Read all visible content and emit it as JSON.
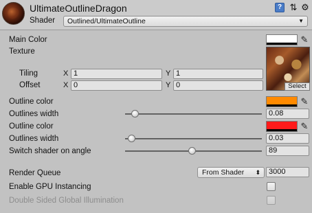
{
  "header": {
    "material_name": "UltimateOutlineDragon",
    "shader_label": "Shader",
    "shader_value": "Outlined/UltimateOutline",
    "icons": [
      "material-preview-icon",
      "help-icon",
      "settings-icon",
      "gear-icon"
    ]
  },
  "properties": {
    "main_color": {
      "label": "Main Color",
      "color": "#ffffff"
    },
    "texture": {
      "label": "Texture",
      "tiling_label": "Tiling",
      "offset_label": "Offset",
      "tiling_x": "1",
      "tiling_y": "1",
      "offset_x": "0",
      "offset_y": "0",
      "x_label": "X",
      "y_label": "Y",
      "select_label": "Select"
    },
    "outline_color_1": {
      "label": "Outline color",
      "color": "#ff8a00"
    },
    "outline_width_1": {
      "label": "Outlines width",
      "value": "0.08",
      "fraction": 0.05
    },
    "outline_color_2": {
      "label": "Outline color",
      "color": "#ff1a1a"
    },
    "outline_width_2": {
      "label": "Outlines width",
      "value": "0.03",
      "fraction": 0.02
    },
    "switch_shader": {
      "label": "Switch shader on angle",
      "value": "89",
      "fraction": 0.49
    }
  },
  "advanced": {
    "render_queue_label": "Render Queue",
    "render_queue_mode": "From Shader",
    "render_queue_value": "3000",
    "gpu_instancing_label": "Enable GPU Instancing",
    "gpu_instancing_checked": false,
    "double_sided_gi_label": "Double Sided Global Illumination",
    "double_sided_gi_checked": false
  },
  "colors": {
    "panel_bg": "#c2c2c2",
    "header_bg": "#cbcbcb"
  }
}
